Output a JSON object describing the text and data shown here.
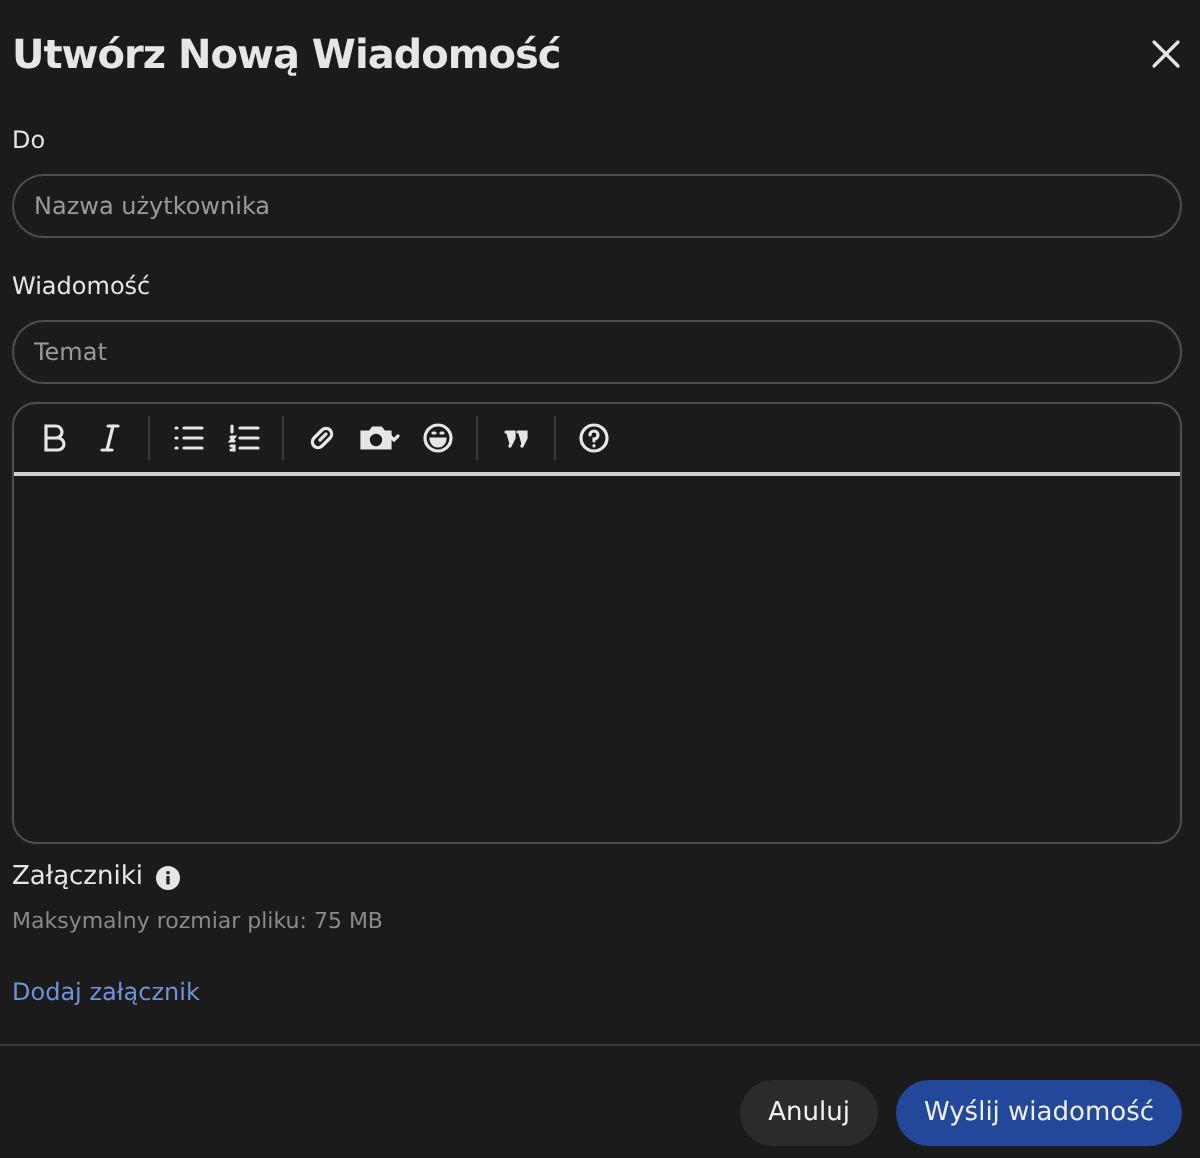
{
  "dialog": {
    "title": "Utwórz Nową Wiadomość"
  },
  "recipient": {
    "label": "Do",
    "placeholder": "Nazwa użytkownika"
  },
  "message": {
    "label": "Wiadomość",
    "subject_placeholder": "Temat"
  },
  "attachments": {
    "label": "Załączniki",
    "hint": "Maksymalny rozmiar pliku: 75 MB",
    "link": "Dodaj załącznik"
  },
  "buttons": [
    {
      "label": "Anuluj",
      "kind": "secondary"
    },
    {
      "label": "Wyślij wiadomość",
      "kind": "primary"
    }
  ]
}
